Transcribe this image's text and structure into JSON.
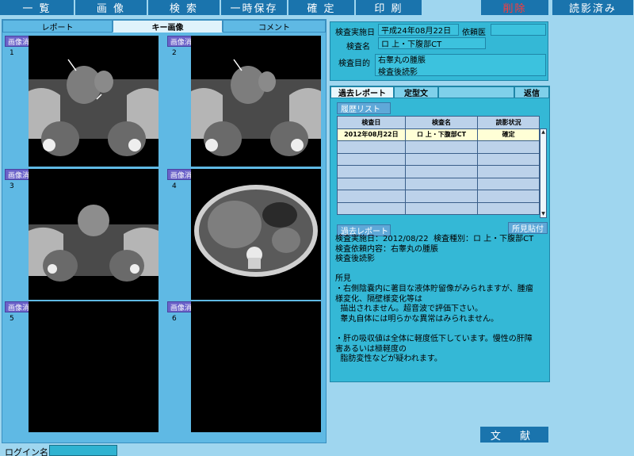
{
  "menu": {
    "list": "一 覧",
    "image": "画 像",
    "search": "検 索",
    "temp_save": "一時保存",
    "confirm": "確 定",
    "print": "印 刷",
    "delete": "削除",
    "read_done": "読影済み"
  },
  "left_tabs": {
    "report": "レポート",
    "key_image": "キー画像",
    "comment": "コメント"
  },
  "cells": [
    {
      "clear": "画像消去",
      "num": "1"
    },
    {
      "clear": "画像消去",
      "num": "2"
    },
    {
      "clear": "画像消去",
      "num": "3"
    },
    {
      "clear": "画像消去",
      "num": "4"
    },
    {
      "clear": "画像消去",
      "num": "5"
    },
    {
      "clear": "画像消去",
      "num": "6"
    }
  ],
  "login": {
    "label": "ログイン名"
  },
  "info": {
    "exam_date_label": "検査実施日",
    "exam_date_value": "平成24年08月22日",
    "requester_label": "依頼医",
    "exam_name_label": "検査名",
    "exam_name_value": "ロ 上・下腹部CT",
    "purpose_label": "検査目的",
    "purpose_line1": "右睾丸の腫脹",
    "purpose_line2": "検査後読影"
  },
  "report_tabs": {
    "past_report": "過去レポート",
    "template": "定型文",
    "reply": "返信"
  },
  "history": {
    "button": "履歴リスト",
    "headers": [
      "検査日",
      "検査名",
      "読影状況"
    ],
    "rows": [
      [
        "2012年08月22日",
        "ロ 上・下腹部CT",
        "確定"
      ],
      [
        "",
        "",
        ""
      ],
      [
        "",
        "",
        ""
      ],
      [
        "",
        "",
        ""
      ],
      [
        "",
        "",
        ""
      ],
      [
        "",
        "",
        ""
      ],
      [
        "",
        "",
        ""
      ]
    ]
  },
  "past_report": {
    "button": "過去レポート",
    "paste_button": "所見貼付",
    "text": "検査実施日：2012/08/22  検査種別：ロ 上・下腹部CT\n検査依頼内容：右睾丸の腫脹\n検査後読影\n\n所見\n・右側陰嚢内に著目な液体貯留像がみられますが、腫瘤\n様変化、隔壁様変化等は\n  描出されません。超音波で評価下さい。\n  睾丸自体には明らかな異常はみられません。\n\n・肝の吸収値は全体に軽度低下しています。慢性の肝障\n害あるいは極軽度の\n  脂肪変性などが疑われます。"
  },
  "footer": {
    "bunken": "文 献"
  },
  "colors": {
    "background": "#9fd6ef",
    "menu_button": "#1a74ad",
    "delete_text": "#ff3b3b",
    "clear_button": "#6b62c9",
    "panel": "#34b8d6"
  }
}
